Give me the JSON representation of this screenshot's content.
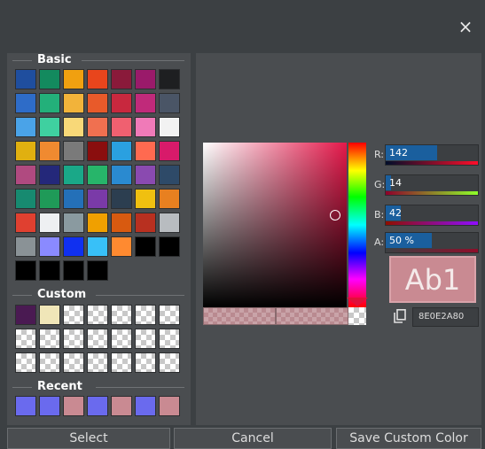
{
  "window": {
    "close_icon": "×"
  },
  "sections": {
    "basic": "Basic",
    "custom": "Custom",
    "recent": "Recent"
  },
  "basic_colors": [
    "#1f4e9e",
    "#138a5e",
    "#f0a010",
    "#e8451c",
    "#8a1a3a",
    "#9a1a6a",
    "#1e1f21",
    "#2e6cc8",
    "#23b07a",
    "#f2b33a",
    "#e85a2a",
    "#c8283e",
    "#c02a7a",
    "#4a5566",
    "#4aa3e8",
    "#3fd0a0",
    "#f8d878",
    "#f07050",
    "#f06070",
    "#f07ab8",
    "#f2f2f2",
    "#e0b010",
    "#f08a30",
    "#7a7a7a",
    "#8a0e0e",
    "#2aa0e0",
    "#ff6a50",
    "#d81a6a",
    "#b04a80",
    "#24287a",
    "#1aa888",
    "#27b56a",
    "#2a8ad0",
    "#8a4ab0",
    "#2e4a68",
    "#178a70",
    "#1f9a58",
    "#2470b8",
    "#7a3aa8",
    "#2c3e50",
    "#f0c010",
    "#e88020",
    "#e04030",
    "#eef0f2",
    "#8a9aa0",
    "#f0a000",
    "#d85a10",
    "#b83020",
    "#b8bcc0",
    "#8a9296",
    "#8a8aff",
    "#1030f0",
    "#38c0f8",
    "#ff8a30",
    "#000000",
    "#000000",
    "#000000",
    "#000000",
    "#000000",
    "#000000"
  ],
  "custom_colors": [
    "#4a1a52",
    "#f0e6b8",
    "checker",
    "checker",
    "checker",
    "checker",
    "checker",
    "checker",
    "checker",
    "checker",
    "checker",
    "checker",
    "checker",
    "checker",
    "checker",
    "checker",
    "checker",
    "checker",
    "checker",
    "checker",
    "checker"
  ],
  "recent_colors": [
    "#6a6aee",
    "#6a6aee",
    "#c98a92",
    "#6a6aee",
    "#c98a92",
    "#6a6aee",
    "#c98a92"
  ],
  "picker": {
    "channels": [
      {
        "label": "R:",
        "value": "142",
        "fraction": 0.557,
        "gradient": "linear-gradient(to right,#000e2a,#ff0e2a)"
      },
      {
        "label": "G:",
        "value": "14",
        "fraction": 0.055,
        "gradient": "linear-gradient(to right,#8e002a,#8eff2a)"
      },
      {
        "label": "B:",
        "value": "42",
        "fraction": 0.165,
        "gradient": "linear-gradient(to right,#8e0e00,#8e0eff)"
      },
      {
        "label": "A:",
        "value": "50 %",
        "fraction": 0.5,
        "gradient": "linear-gradient(to right,rgba(142,14,42,0),#8e0e2a)"
      }
    ],
    "preview_text": "Ab1",
    "hex_value": "8E0E2A80"
  },
  "buttons": {
    "select": "Select",
    "cancel": "Cancel",
    "save_custom": "Save Custom Color"
  }
}
